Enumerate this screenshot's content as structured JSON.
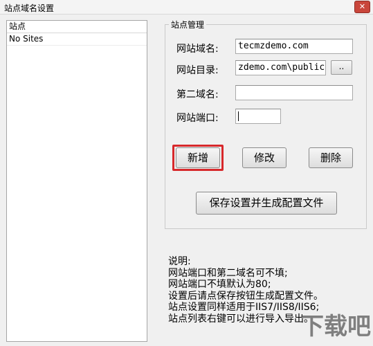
{
  "window": {
    "title": "站点域名设置",
    "close_label": "✕"
  },
  "site_list": {
    "header": "站点",
    "items": [
      "No Sites"
    ]
  },
  "site_management": {
    "legend": "站点管理",
    "domain_label": "网站域名:",
    "domain_value": "tecmzdemo.com",
    "directory_label": "网站目录:",
    "directory_value": "zdemo.com\\public",
    "browse_label": "..",
    "second_domain_label": "第二域名:",
    "second_domain_value": "",
    "port_label": "网站端口:",
    "port_value": "",
    "add_button": "新增",
    "modify_button": "修改",
    "delete_button": "删除",
    "save_button": "保存设置并生成配置文件"
  },
  "notes": [
    "说明:",
    "网站端口和第二域名可不填;",
    "网站端口不填默认为80;",
    "设置后请点保存按钮生成配置文件。",
    "站点设置同样适用于IIS7/IIS8/IIS6;",
    "站点列表右键可以进行导入导出。"
  ],
  "watermark": "下载吧",
  "colors": {
    "highlight": "#d7282b",
    "close_button": "#c9463b"
  }
}
